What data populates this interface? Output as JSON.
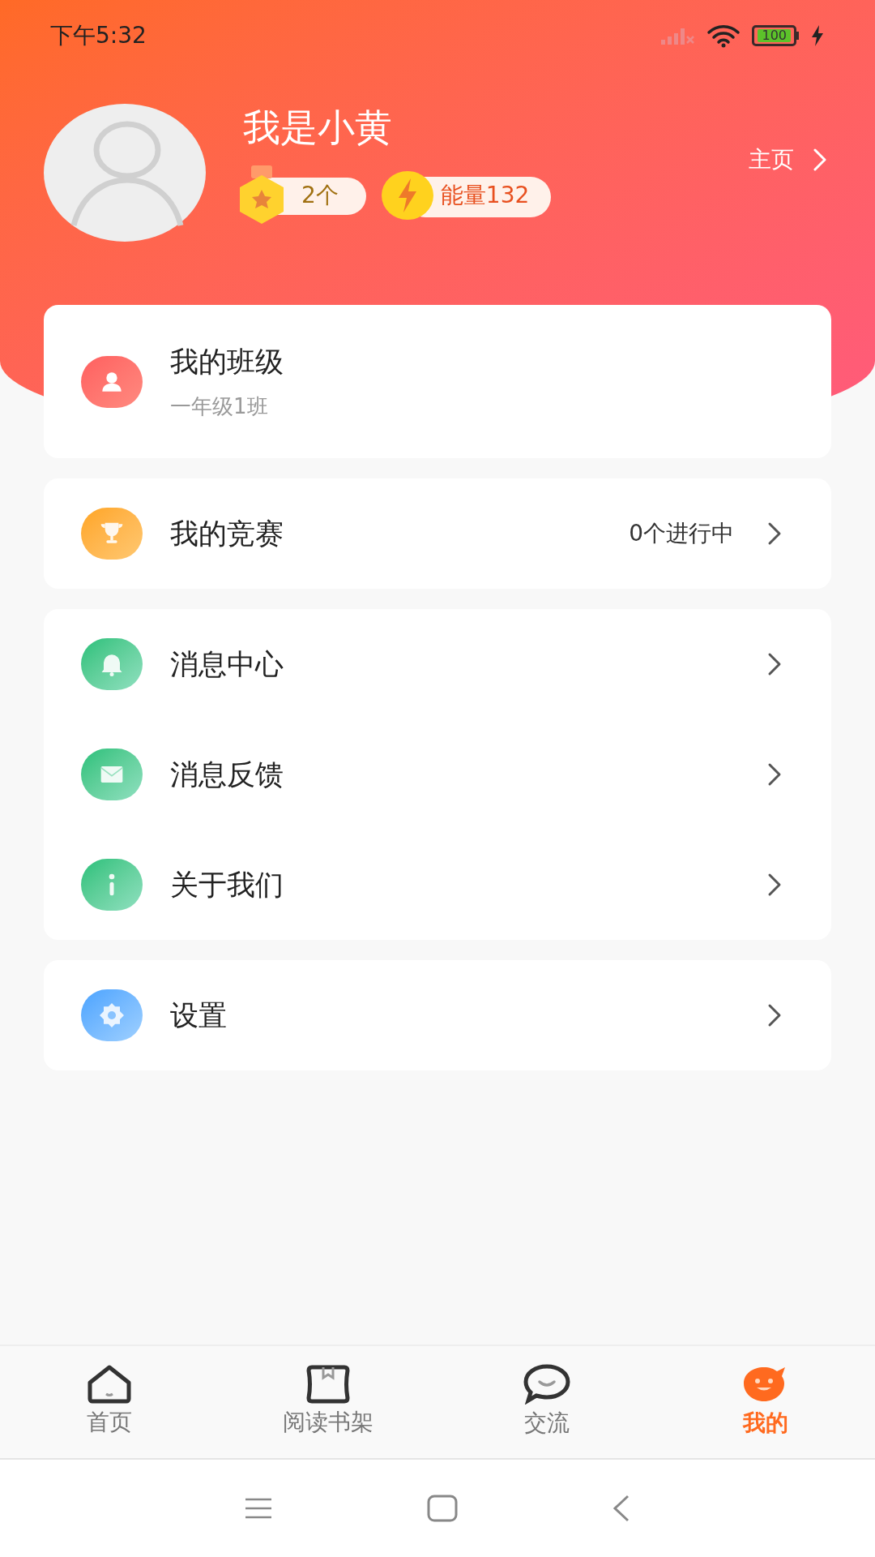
{
  "status_bar": {
    "time": "下午5:32",
    "battery": "100"
  },
  "profile": {
    "name": "我是小黄",
    "home_link": "主页",
    "badges": [
      {
        "kind": "medal",
        "text": "2个"
      },
      {
        "kind": "energy",
        "text": "能量132"
      }
    ]
  },
  "menu_groups": [
    {
      "items": [
        {
          "kind": "class",
          "label": "我的班级",
          "subtitle": "一年级1班",
          "chevron": false
        }
      ]
    },
    {
      "items": [
        {
          "kind": "contest",
          "label": "我的竞赛",
          "value": "0个进行中",
          "chevron": true
        }
      ]
    },
    {
      "items": [
        {
          "kind": "bell",
          "label": "消息中心",
          "chevron": true
        },
        {
          "kind": "mail",
          "label": "消息反馈",
          "chevron": true
        },
        {
          "kind": "info",
          "label": "关于我们",
          "chevron": true
        }
      ]
    },
    {
      "items": [
        {
          "kind": "settings",
          "label": "设置",
          "chevron": true
        }
      ]
    }
  ],
  "tabs": [
    {
      "kind": "home",
      "label": "首页",
      "selected": false
    },
    {
      "kind": "shelf",
      "label": "阅读书架",
      "selected": false
    },
    {
      "kind": "chat",
      "label": "交流",
      "selected": false
    },
    {
      "kind": "me",
      "label": "我的",
      "selected": true
    }
  ]
}
